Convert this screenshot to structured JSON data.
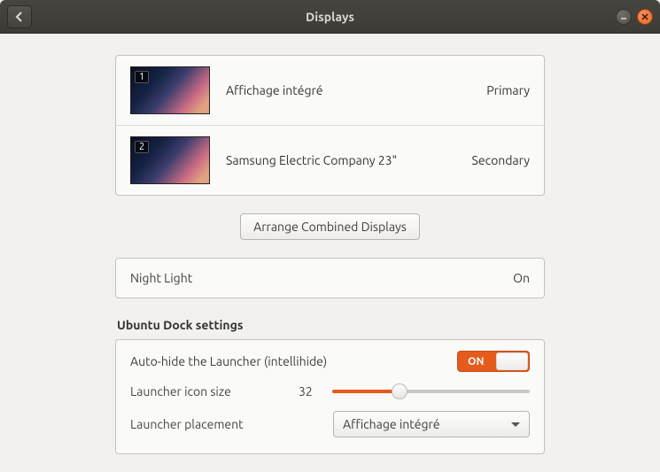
{
  "window": {
    "title": "Displays"
  },
  "displays": {
    "items": [
      {
        "number": "1",
        "name": "Affichage intégré",
        "role": "Primary"
      },
      {
        "number": "2",
        "name": "Samsung Electric Company 23\"",
        "role": "Secondary"
      }
    ],
    "arrange_button": "Arrange Combined Displays"
  },
  "night_light": {
    "label": "Night Light",
    "status": "On"
  },
  "dock": {
    "heading": "Ubuntu Dock settings",
    "autohide_label": "Auto-hide the Launcher (intellihide)",
    "toggle_label": "ON",
    "icon_size_label": "Launcher icon size",
    "icon_size_value": "32",
    "placement_label": "Launcher placement",
    "placement_value": "Affichage intégré"
  }
}
